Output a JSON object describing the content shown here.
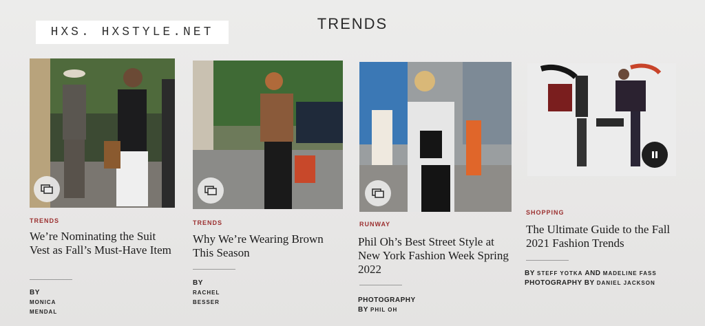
{
  "watermark": "HXS. HXSTYLE.NET",
  "section_title": "TRENDS",
  "cards": [
    {
      "rubric": "TRENDS",
      "headline": "We’re Nominating the Suit Vest as Fall’s Must-Have Item",
      "byline_prefix": "BY",
      "byline_name": "MONICA MENDAL",
      "media_icon": "gallery-icon"
    },
    {
      "rubric": "TRENDS",
      "headline": "Why We’re Wearing Brown This Season",
      "byline_prefix": "BY",
      "byline_name": "RACHEL BESSER",
      "media_icon": "gallery-icon"
    },
    {
      "rubric": "RUNWAY",
      "headline": "Phil Oh’s Best Street Style at New York Fashion Week Spring 2022",
      "byline_prefix": "PHOTOGRAPHY BY",
      "byline_name": "PHIL OH",
      "media_icon": "gallery-icon"
    },
    {
      "rubric": "SHOPPING",
      "headline": "The Ultimate Guide to the Fall 2021 Fashion Trends",
      "byline_prefix": "BY",
      "byline_name": "STEFF YOTKA",
      "byline_and": "AND",
      "byline_name2": "MADELINE FASS",
      "byline_prefix2": "PHOTOGRAPHY BY",
      "byline_name3": "DANIEL JACKSON",
      "media_icon": "pause-icon"
    }
  ],
  "colors": {
    "rubric": "#9b2f2f",
    "background": "#ebeae9",
    "text": "#1c1c1c"
  }
}
